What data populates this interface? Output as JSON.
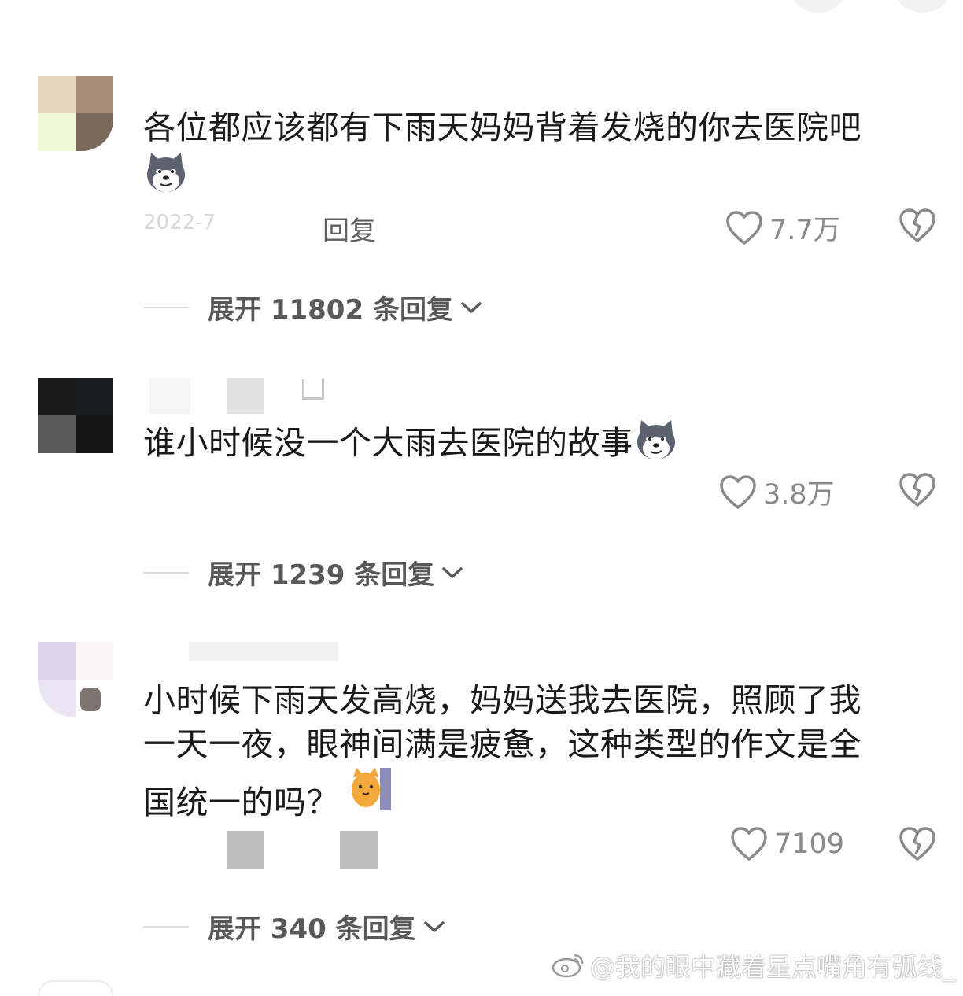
{
  "comments": [
    {
      "text": "各位都应该都有下雨天妈妈背着发烧的你去医院吧",
      "time": "2022-7",
      "reply_label": "回复",
      "likes": "7.7万",
      "expand_label": "展开 11802 条回复"
    },
    {
      "text": "谁小时候没一个大雨去医院的故事",
      "likes": "3.8万",
      "expand_label": "展开 1239 条回复"
    },
    {
      "text_lines": [
        "小时候下雨天发高烧，妈妈送我去医院，照顾了我",
        "一天一夜，眼神间满是疲惫，这种类型的作文是全",
        "国统一的吗？"
      ],
      "likes": "7109",
      "expand_label": "展开 340 条回复"
    }
  ],
  "watermark": "@我的眼中藏着星点嘴角有弧线_",
  "colors": {
    "text": "#1a1a1a",
    "secondary": "#8a8a8a",
    "expand": "#595959"
  }
}
